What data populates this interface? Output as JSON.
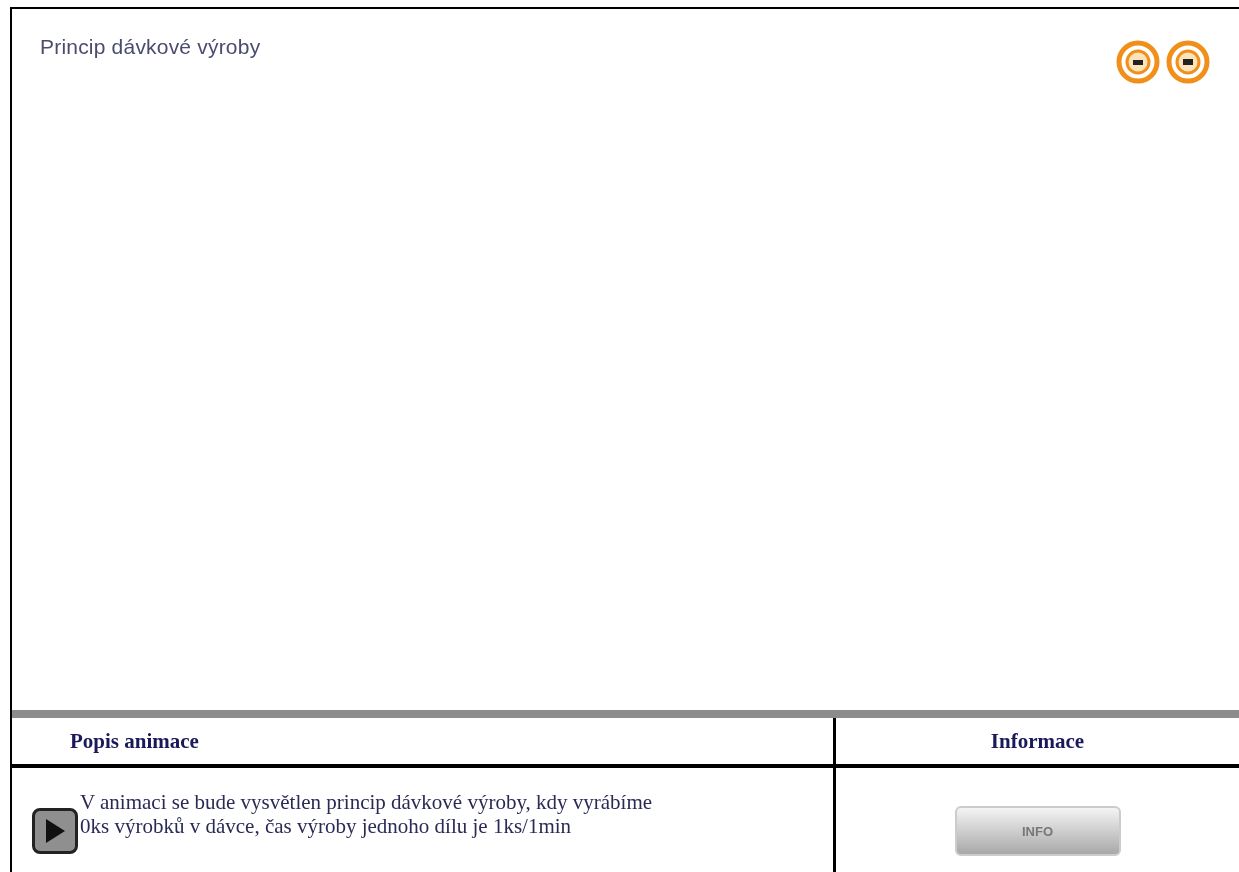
{
  "title": "Princip dávkové výroby",
  "table": {
    "columns": [
      "Popis animace",
      "Informace"
    ],
    "description": [
      "V animaci se bude vysvětlen princip dávkové výroby, kdy vyrábíme",
      "0ks výrobků v dávce, čas výroby jednoho dílu je 1ks/1min"
    ],
    "info_button": "INFO"
  }
}
